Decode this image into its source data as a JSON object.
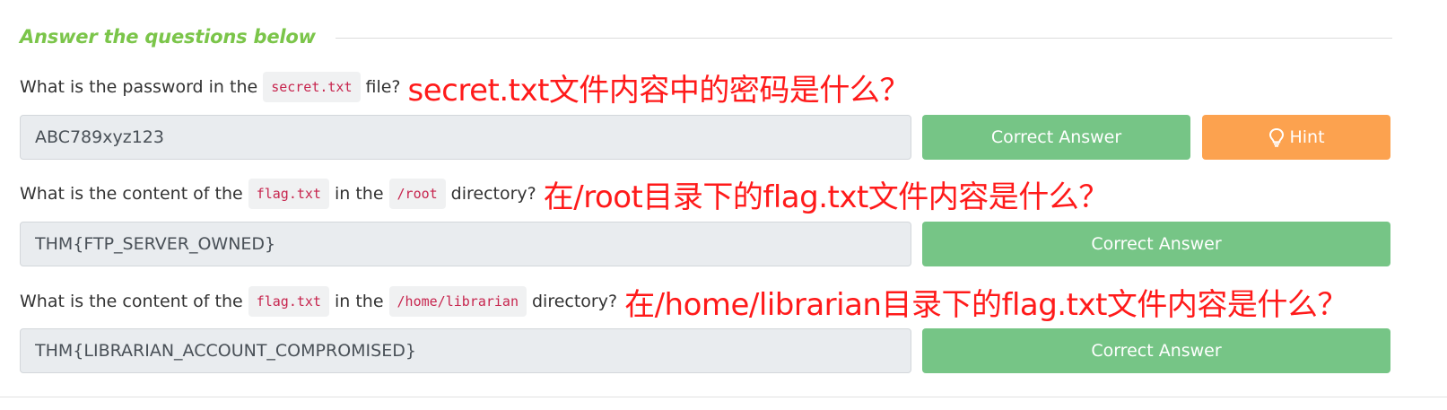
{
  "section": {
    "title": "Answer the questions below"
  },
  "questions": [
    {
      "parts": [
        "What is the password in the",
        "secret.txt",
        "file?"
      ],
      "annotation": "secret.txt文件内容中的密码是什么？",
      "answer": "ABC789xyz123",
      "correct_label": "Correct Answer",
      "hint_label": "Hint"
    },
    {
      "parts": [
        "What is the content of the",
        "flag.txt",
        "in the",
        "/root",
        "directory?"
      ],
      "annotation": "在/root目录下的flag.txt文件内容是什么？",
      "answer": "THM{FTP_SERVER_OWNED}",
      "correct_label": "Correct Answer"
    },
    {
      "parts": [
        "What is the content of the",
        "flag.txt",
        "in the",
        "/home/librarian",
        "directory?"
      ],
      "annotation": "在/home/librarian目录下的flag.txt文件内容是什么？",
      "answer": "THM{LIBRARIAN_ACCOUNT_COMPROMISED}",
      "correct_label": "Correct Answer"
    }
  ],
  "colors": {
    "section_title": "#7bc54a",
    "correct_button": "#76c586",
    "hint_button": "#fca24f",
    "code_text": "#c7254e",
    "annotation": "#ff1a1a"
  },
  "icons": {
    "hint": "lightbulb-icon"
  }
}
